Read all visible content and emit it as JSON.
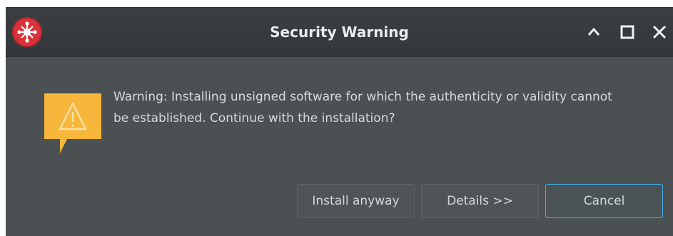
{
  "window": {
    "title": "Security Warning",
    "icon": "app-logo-icon",
    "controls": {
      "maximize_icon": "chevron-up-icon",
      "restore_icon": "square-icon",
      "close_icon": "close-icon"
    }
  },
  "dialog": {
    "warning_icon": "warning-triangle-icon",
    "message_line1": "Warning: Installing unsigned software for which the authenticity or validity cannot",
    "message_line2": "be established. Continue with the installation?"
  },
  "buttons": {
    "install_label": "Install anyway",
    "details_label": "Details >>",
    "cancel_label": "Cancel"
  },
  "colors": {
    "background": "#4b5053",
    "titlebar": "#36393c",
    "focus_accent": "#3daee9",
    "warning": "#f6b73c"
  }
}
